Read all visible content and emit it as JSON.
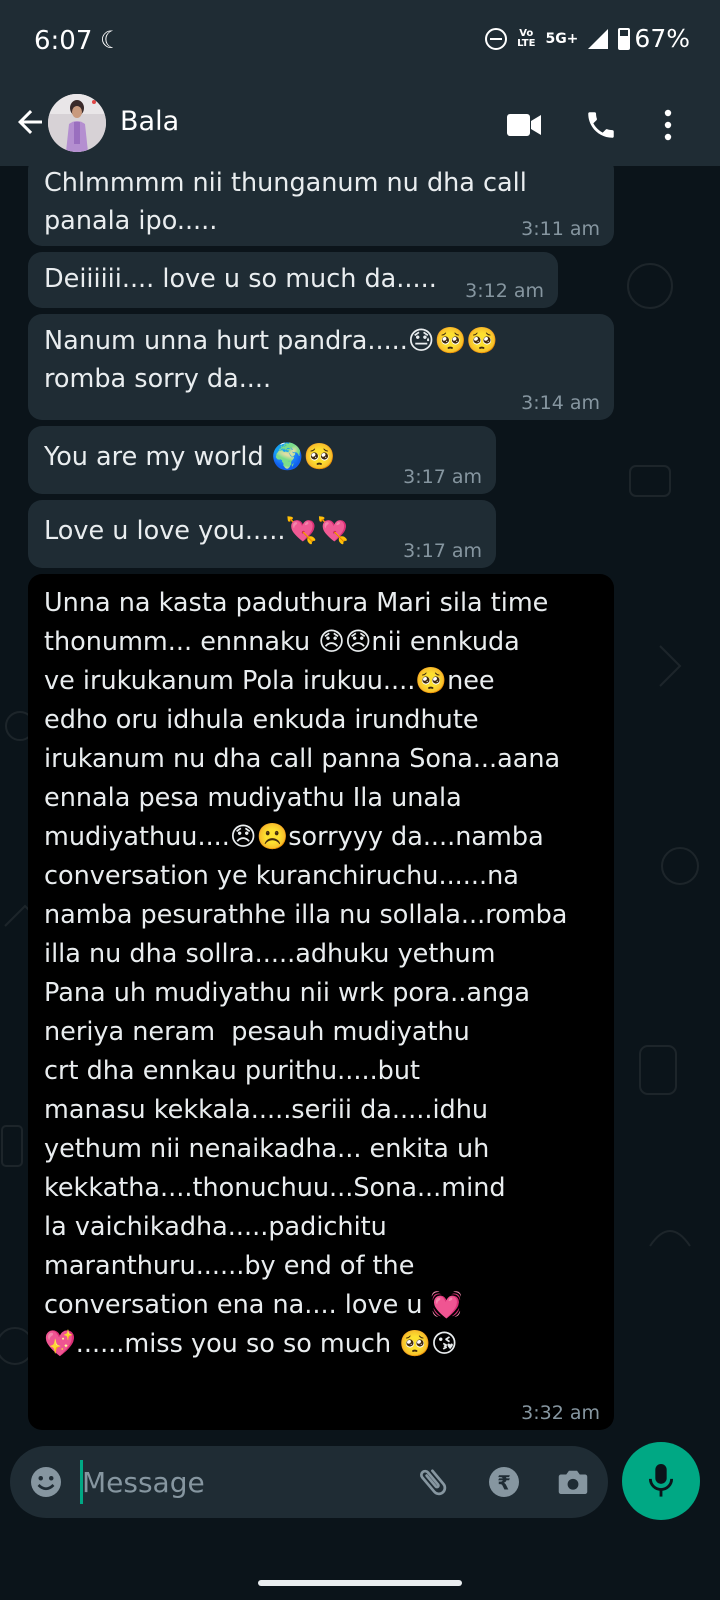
{
  "status_bar": {
    "time": "6:07",
    "network_volte": "Vo LTE",
    "network_type": "5G+",
    "battery": "67%"
  },
  "header": {
    "contact_name": "Bala",
    "icons": [
      "back-arrow-icon",
      "video-call-icon",
      "voice-call-icon",
      "more-options-icon"
    ]
  },
  "messages": [
    {
      "lines": [
        "Chlmmmm nii thunganum nu dha call",
        "panala ipo....."
      ],
      "time": "3:11 am"
    },
    {
      "lines": [
        "Deiiiiii.... love u so much da....."
      ],
      "time": "3:12 am"
    },
    {
      "lines": [
        "Nanum unna hurt pandra.....😓🥺🥺",
        "romba sorry da...."
      ],
      "time": "3:14 am"
    },
    {
      "lines": [
        "You are my world 🌍🥺"
      ],
      "time": "3:17 am"
    },
    {
      "lines": [
        "Love u love you.....💘💘"
      ],
      "time": "3:17 am"
    },
    {
      "lines": [
        "Unna na kasta paduthura Mari sila time",
        "thonumm... ennnaku 😞😞nii ennkuda",
        "ve irukukanum Pola irukuu....🥺nee",
        "edho oru idhula enkuda irundhute",
        "irukanum nu dha call panna Sona...aana",
        "ennala pesa mudiyathu Ila unala",
        "mudiyathuu....😞☹️sorryyy da....namba",
        "conversation ye kuranchiruchu......na",
        "namba pesurathhe illa nu sollala...romba",
        "illa nu dha sollra.....adhuku yethum",
        "Pana uh mudiyathu nii wrk pora..anga",
        "neriya neram  pesauh mudiyathu",
        "crt dha ennkau purithu.....but",
        "manasu kekkala.....seriii da.....idhu",
        "yethum nii nenaikadha... enkita uh",
        "kekkatha....thonuchuu...Sona...mind",
        "la vaichikadha.....padichitu",
        "maranthuru......by end of the",
        "conversation ena na.... love u 💓",
        "💖......miss you so so much 🥺😘"
      ],
      "time": "3:32 am"
    }
  ],
  "input": {
    "placeholder": "Message"
  },
  "colors": {
    "background": "#0b141a",
    "bubble_incoming": "#1f2c34",
    "accent": "#00a884"
  }
}
